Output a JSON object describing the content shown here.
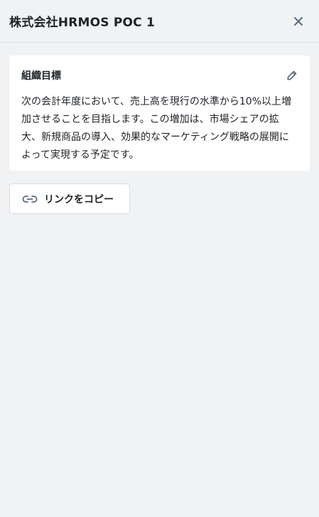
{
  "header": {
    "title": "株式会社HRMOS POC 1",
    "close_icon": "close-icon"
  },
  "goal_card": {
    "title": "組織目標",
    "edit_icon": "pencil-icon",
    "body": "次の会計年度において、売上高を現行の水準から10%以上増加させることを目指します。この増加は、市場シェアの拡大、新規商品の導入、効果的なマーケティング戦略の展開によって実現する予定です。"
  },
  "copy_link": {
    "label": "リンクをコピー",
    "icon": "link-icon"
  },
  "colors": {
    "background": "#f1f2f4",
    "card": "#ffffff",
    "icon": "#5a6b82",
    "text": "#1f2328"
  }
}
